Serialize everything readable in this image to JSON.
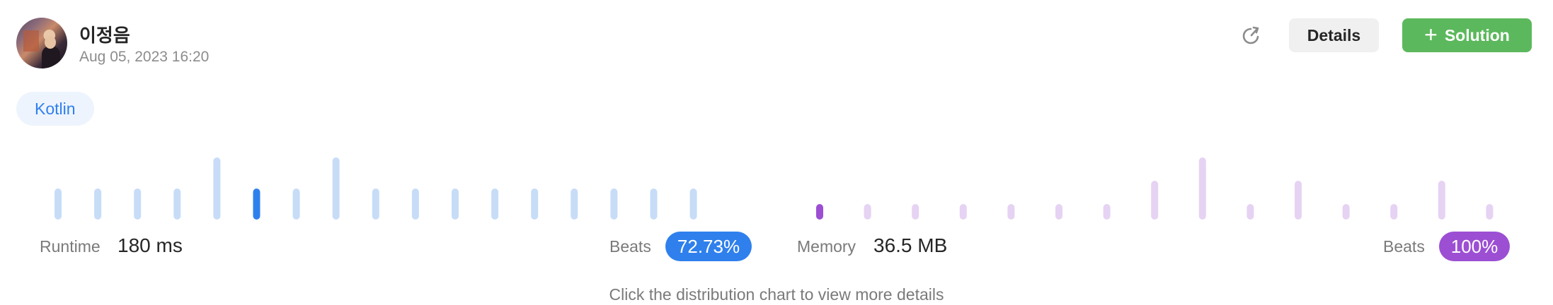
{
  "submission": {
    "username": "이정음",
    "datetime": "Aug 05, 2023 16:20",
    "language": "Kotlin"
  },
  "toolbar": {
    "refresh_icon": "refresh-icon",
    "details_label": "Details",
    "solution_label": "Solution",
    "solution_icon": "plus-icon"
  },
  "runtime": {
    "label": "Runtime",
    "value": "180 ms",
    "beats_label": "Beats",
    "beats_value": "72.73%",
    "accent": "#2f80ed",
    "bar_color": "#c7dcf7",
    "selected_index": 5,
    "distribution": [
      2,
      2,
      2,
      2,
      4,
      2,
      2,
      4,
      2,
      2,
      2,
      2,
      2,
      2,
      2,
      2,
      2
    ]
  },
  "memory": {
    "label": "Memory",
    "value": "36.5 MB",
    "beats_label": "Beats",
    "beats_value": "100%",
    "accent": "#9c4fd3",
    "bar_color": "#e6d3f3",
    "selected_index": 0,
    "distribution": [
      1,
      1,
      1,
      1,
      1,
      1,
      1,
      2.5,
      4,
      1,
      2.5,
      1,
      1,
      2.5,
      1
    ]
  },
  "hint": "Click the distribution chart to view more details"
}
